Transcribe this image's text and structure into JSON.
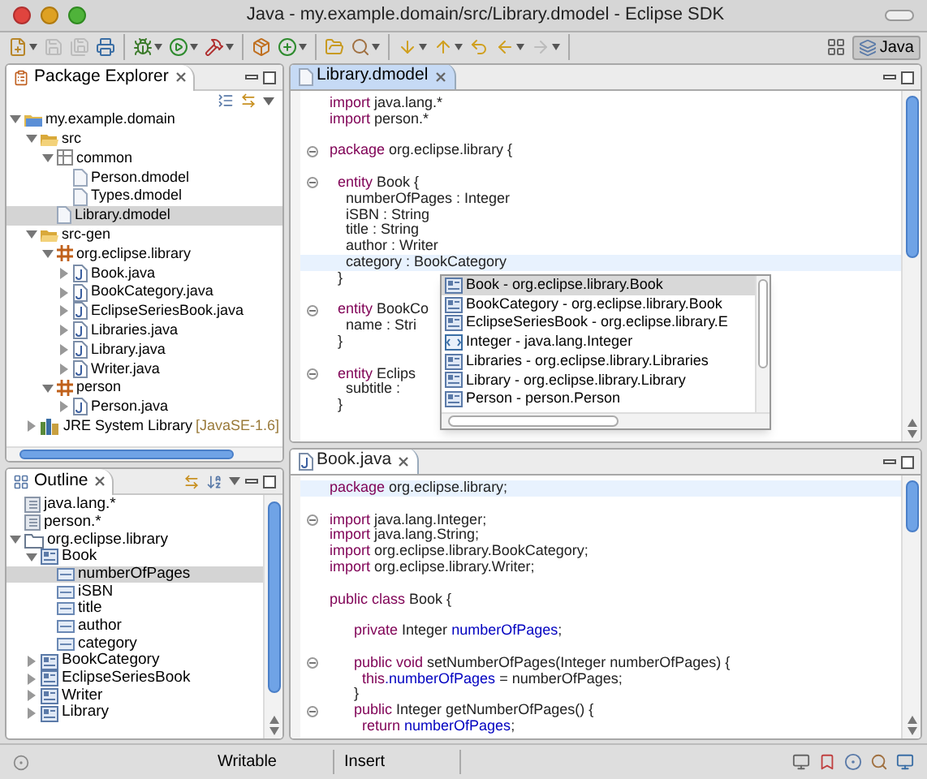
{
  "window": {
    "title": "Java - my.example.domain/src/Library.dmodel - Eclipse SDK"
  },
  "toolbar": [
    [
      {
        "kind": "new",
        "dropdown": true,
        "disabled": false
      },
      {
        "kind": "save",
        "dropdown": false,
        "disabled": true
      },
      {
        "kind": "save_all",
        "dropdown": false,
        "disabled": true
      },
      {
        "kind": "print",
        "dropdown": false,
        "disabled": false
      }
    ],
    [
      {
        "kind": "debug",
        "dropdown": true,
        "disabled": false
      },
      {
        "kind": "run",
        "dropdown": true,
        "disabled": false
      },
      {
        "kind": "external",
        "dropdown": true,
        "disabled": false
      }
    ],
    [
      {
        "kind": "new_package",
        "dropdown": false,
        "disabled": false
      },
      {
        "kind": "new_class",
        "dropdown": true,
        "disabled": false
      }
    ],
    [
      {
        "kind": "open_type",
        "dropdown": false,
        "disabled": false
      },
      {
        "kind": "search",
        "dropdown": true,
        "disabled": false
      }
    ],
    [
      {
        "kind": "next",
        "dropdown": true,
        "disabled": false
      },
      {
        "kind": "prev",
        "dropdown": true,
        "disabled": false
      },
      {
        "kind": "last_edit",
        "dropdown": false,
        "disabled": false
      },
      {
        "kind": "back",
        "dropdown": true,
        "disabled": false
      },
      {
        "kind": "forward",
        "dropdown": true,
        "disabled": true
      }
    ]
  ],
  "perspectives": [
    {
      "label": "Java",
      "selected": true
    }
  ],
  "package_explorer": {
    "title": "Package Explorer",
    "tree": [
      {
        "label": "my.example.domain",
        "kind": "project",
        "expanded": true,
        "selected": false,
        "children": [
          {
            "label": "src",
            "kind": "folder",
            "expanded": true,
            "selected": false,
            "children": [
              {
                "label": "common",
                "kind": "package_plain",
                "expanded": true,
                "selected": false,
                "children": [
                  {
                    "label": "Person.dmodel",
                    "kind": "file",
                    "selected": false
                  },
                  {
                    "label": "Types.dmodel",
                    "kind": "file",
                    "selected": false
                  }
                ]
              },
              {
                "label": "Library.dmodel",
                "kind": "file",
                "selected": true
              }
            ]
          },
          {
            "label": "src-gen",
            "kind": "folder",
            "expanded": true,
            "selected": false,
            "children": [
              {
                "label": "org.eclipse.library",
                "kind": "package",
                "expanded": true,
                "selected": false,
                "children": [
                  {
                    "label": "Book.java",
                    "kind": "java",
                    "expanded": false,
                    "selected": false
                  },
                  {
                    "label": "BookCategory.java",
                    "kind": "java",
                    "expanded": false,
                    "selected": false
                  },
                  {
                    "label": "EclipseSeriesBook.java",
                    "kind": "java",
                    "expanded": false,
                    "selected": false
                  },
                  {
                    "label": "Libraries.java",
                    "kind": "java",
                    "expanded": false,
                    "selected": false
                  },
                  {
                    "label": "Library.java",
                    "kind": "java",
                    "expanded": false,
                    "selected": false
                  },
                  {
                    "label": "Writer.java",
                    "kind": "java",
                    "expanded": false,
                    "selected": false
                  }
                ]
              },
              {
                "label": "person",
                "kind": "package",
                "expanded": true,
                "selected": false,
                "children": [
                  {
                    "label": "Person.java",
                    "kind": "java",
                    "expanded": false,
                    "selected": false
                  }
                ]
              }
            ]
          },
          {
            "label": "JRE System Library",
            "decoration": "[JavaSE-1.6]",
            "kind": "library",
            "expanded": false,
            "selected": false
          }
        ]
      }
    ]
  },
  "outline": {
    "title": "Outline",
    "tree": [
      {
        "label": "java.lang.*",
        "kind": "import",
        "selected": false
      },
      {
        "label": "person.*",
        "kind": "import",
        "selected": false
      },
      {
        "label": "org.eclipse.library",
        "kind": "package_outline",
        "expanded": true,
        "selected": false,
        "children": [
          {
            "label": "Book",
            "kind": "class",
            "expanded": true,
            "selected": false,
            "children": [
              {
                "label": "numberOfPages",
                "kind": "field",
                "selected": true
              },
              {
                "label": "iSBN",
                "kind": "field",
                "selected": false
              },
              {
                "label": "title",
                "kind": "field",
                "selected": false
              },
              {
                "label": "author",
                "kind": "field",
                "selected": false
              },
              {
                "label": "category",
                "kind": "field",
                "selected": false
              }
            ]
          },
          {
            "label": "BookCategory",
            "kind": "class",
            "expanded": false,
            "selected": false
          },
          {
            "label": "EclipseSeriesBook",
            "kind": "class",
            "expanded": false,
            "selected": false
          },
          {
            "label": "Writer",
            "kind": "class",
            "expanded": false,
            "selected": false
          },
          {
            "label": "Library",
            "kind": "class",
            "expanded": false,
            "selected": false
          }
        ]
      }
    ]
  },
  "editors": [
    {
      "tab": {
        "label": "Library.dmodel",
        "kind": "model",
        "active": true
      },
      "lines": [
        {
          "kind": "code",
          "fold": false,
          "current": false,
          "segments": [
            {
              "text": "import",
              "kind": "keyword"
            },
            {
              "text": " java.lang.*",
              "kind": "plain"
            }
          ]
        },
        {
          "kind": "code",
          "fold": false,
          "current": false,
          "segments": [
            {
              "text": "import",
              "kind": "keyword"
            },
            {
              "text": " person.*",
              "kind": "plain"
            }
          ]
        },
        {
          "kind": "blank"
        },
        {
          "kind": "code",
          "fold": true,
          "current": false,
          "segments": [
            {
              "text": "package",
              "kind": "keyword"
            },
            {
              "text": " org.eclipse.library {",
              "kind": "plain"
            }
          ]
        },
        {
          "kind": "blank"
        },
        {
          "kind": "code",
          "fold": true,
          "current": false,
          "segments": [
            {
              "text": "  entity",
              "kind": "keyword"
            },
            {
              "text": " Book {",
              "kind": "plain"
            }
          ]
        },
        {
          "kind": "code",
          "fold": false,
          "current": false,
          "segments": [
            {
              "text": "    numberOfPages : Integer",
              "kind": "plain"
            }
          ]
        },
        {
          "kind": "code",
          "fold": false,
          "current": false,
          "segments": [
            {
              "text": "    iSBN : String",
              "kind": "plain"
            }
          ]
        },
        {
          "kind": "code",
          "fold": false,
          "current": false,
          "segments": [
            {
              "text": "    title : String",
              "kind": "plain"
            }
          ]
        },
        {
          "kind": "code",
          "fold": false,
          "current": false,
          "segments": [
            {
              "text": "    author : Writer",
              "kind": "plain"
            }
          ]
        },
        {
          "kind": "code",
          "fold": false,
          "current": true,
          "segments": [
            {
              "text": "    category : BookCategory",
              "kind": "plain"
            }
          ]
        },
        {
          "kind": "code",
          "fold": false,
          "current": false,
          "segments": [
            {
              "text": "  }",
              "kind": "plain"
            }
          ]
        },
        {
          "kind": "blank"
        },
        {
          "kind": "code",
          "fold": true,
          "current": false,
          "segments": [
            {
              "text": "  entity",
              "kind": "keyword"
            },
            {
              "text": " BookCo",
              "kind": "plain"
            }
          ]
        },
        {
          "kind": "code",
          "fold": false,
          "current": false,
          "segments": [
            {
              "text": "    name : Stri",
              "kind": "plain"
            }
          ]
        },
        {
          "kind": "code",
          "fold": false,
          "current": false,
          "segments": [
            {
              "text": "  }",
              "kind": "plain"
            }
          ]
        },
        {
          "kind": "blank"
        },
        {
          "kind": "code",
          "fold": true,
          "current": false,
          "segments": [
            {
              "text": "  entity",
              "kind": "keyword"
            },
            {
              "text": " Eclips",
              "kind": "plain"
            }
          ]
        },
        {
          "kind": "code",
          "fold": false,
          "current": false,
          "segments": [
            {
              "text": "    subtitle :",
              "kind": "plain"
            }
          ]
        },
        {
          "kind": "code",
          "fold": false,
          "current": false,
          "segments": [
            {
              "text": "  }",
              "kind": "plain"
            }
          ]
        }
      ],
      "completion": [
        {
          "label": "Book - org.eclipse.library.Book",
          "kind": "class",
          "selected": true
        },
        {
          "label": "BookCategory - org.eclipse.library.Book",
          "kind": "class",
          "selected": false
        },
        {
          "label": "EclipseSeriesBook - org.eclipse.library.E",
          "kind": "class",
          "selected": false
        },
        {
          "label": "Integer - java.lang.Integer",
          "kind": "type",
          "selected": false
        },
        {
          "label": "Libraries - org.eclipse.library.Libraries",
          "kind": "class",
          "selected": false
        },
        {
          "label": "Library - org.eclipse.library.Library",
          "kind": "class",
          "selected": false
        },
        {
          "label": "Person - person.Person",
          "kind": "class",
          "selected": false
        }
      ]
    },
    {
      "tab": {
        "label": "Book.java",
        "kind": "java",
        "active": false
      },
      "lines": [
        {
          "kind": "code",
          "fold": false,
          "current": true,
          "segments": [
            {
              "text": "package",
              "kind": "keyword"
            },
            {
              "text": " org.eclipse.library;",
              "kind": "plain"
            }
          ]
        },
        {
          "kind": "blank"
        },
        {
          "kind": "code",
          "fold": true,
          "current": false,
          "segments": [
            {
              "text": "import",
              "kind": "keyword"
            },
            {
              "text": " java.lang.Integer;",
              "kind": "plain"
            }
          ]
        },
        {
          "kind": "code",
          "fold": false,
          "current": false,
          "segments": [
            {
              "text": "import",
              "kind": "keyword"
            },
            {
              "text": " java.lang.String;",
              "kind": "plain"
            }
          ]
        },
        {
          "kind": "code",
          "fold": false,
          "current": false,
          "segments": [
            {
              "text": "import",
              "kind": "keyword"
            },
            {
              "text": " org.eclipse.library.BookCategory;",
              "kind": "plain"
            }
          ]
        },
        {
          "kind": "code",
          "fold": false,
          "current": false,
          "segments": [
            {
              "text": "import",
              "kind": "keyword"
            },
            {
              "text": " org.eclipse.library.Writer;",
              "kind": "plain"
            }
          ]
        },
        {
          "kind": "blank"
        },
        {
          "kind": "code",
          "fold": false,
          "current": false,
          "segments": [
            {
              "text": "public class",
              "kind": "keyword"
            },
            {
              "text": " Book {",
              "kind": "plain"
            }
          ]
        },
        {
          "kind": "blank"
        },
        {
          "kind": "code",
          "fold": false,
          "current": false,
          "segments": [
            {
              "text": "      private",
              "kind": "keyword"
            },
            {
              "text": " Integer ",
              "kind": "plain"
            },
            {
              "text": "numberOfPages",
              "kind": "field"
            },
            {
              "text": ";",
              "kind": "plain"
            }
          ]
        },
        {
          "kind": "blank"
        },
        {
          "kind": "code",
          "fold": true,
          "current": false,
          "segments": [
            {
              "text": "      public void",
              "kind": "keyword"
            },
            {
              "text": " setNumberOfPages(Integer numberOfPages) {",
              "kind": "plain"
            }
          ]
        },
        {
          "kind": "code",
          "fold": false,
          "current": false,
          "segments": [
            {
              "text": "        this",
              "kind": "keyword"
            },
            {
              "text": ".numberOfPages",
              "kind": "field"
            },
            {
              "text": " = numberOfPages;",
              "kind": "plain"
            }
          ]
        },
        {
          "kind": "code",
          "fold": false,
          "current": false,
          "segments": [
            {
              "text": "      }",
              "kind": "plain"
            }
          ]
        },
        {
          "kind": "code",
          "fold": true,
          "current": false,
          "segments": [
            {
              "text": "      public",
              "kind": "keyword"
            },
            {
              "text": " Integer getNumberOfPages() {",
              "kind": "plain"
            }
          ]
        },
        {
          "kind": "code",
          "fold": false,
          "current": false,
          "segments": [
            {
              "text": "        return",
              "kind": "keyword"
            },
            {
              "text": " numberOfPages",
              "kind": "field"
            },
            {
              "text": ";",
              "kind": "plain"
            }
          ]
        }
      ]
    }
  ],
  "status_bar": {
    "fields": [
      "Writable",
      "Insert"
    ]
  }
}
